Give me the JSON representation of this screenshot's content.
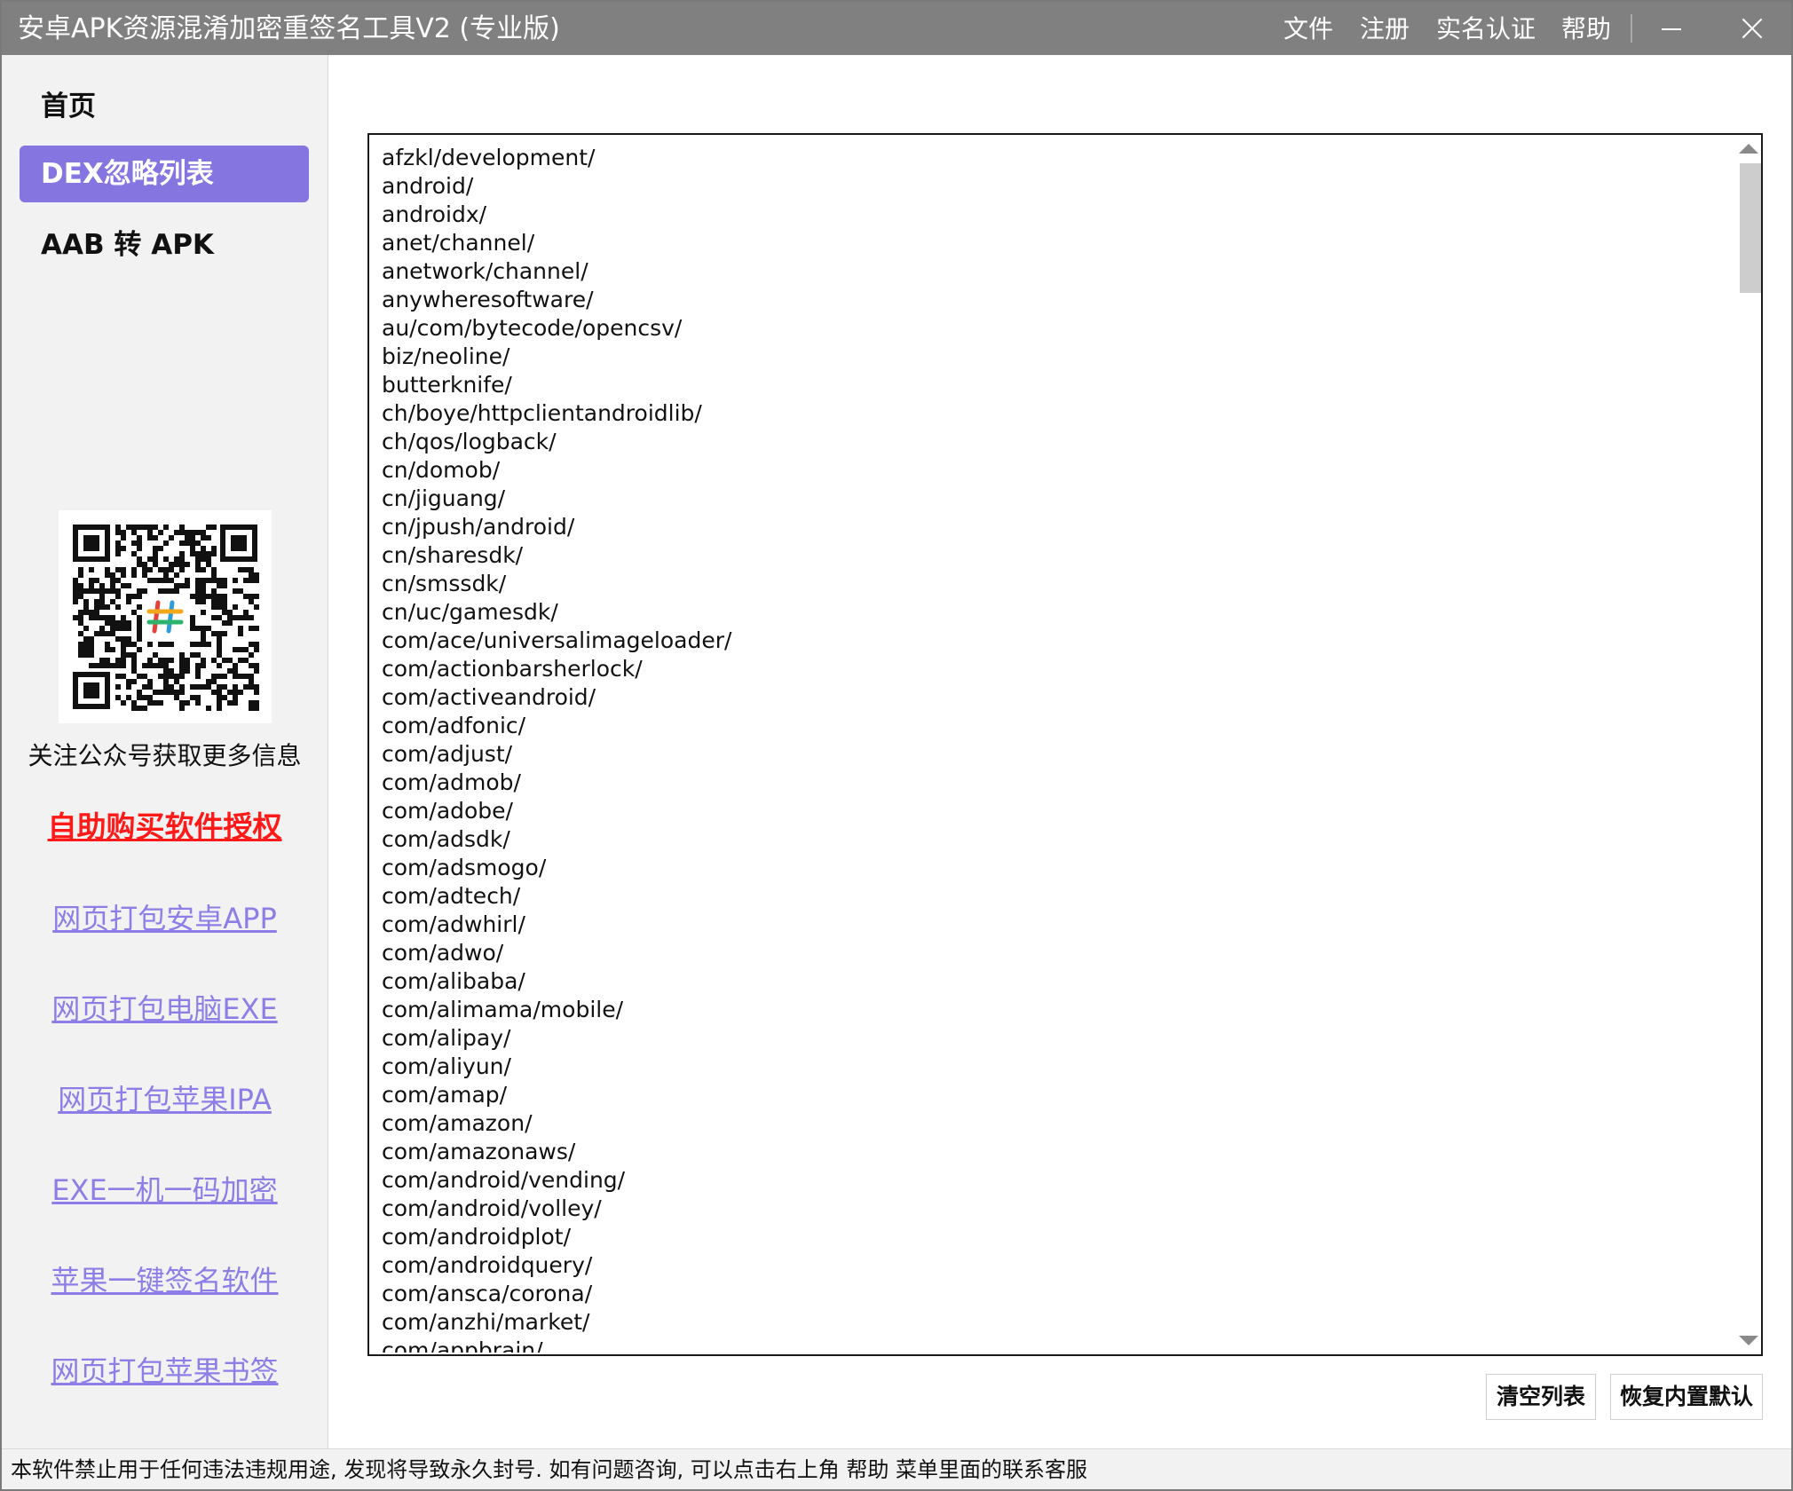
{
  "window": {
    "title": "安卓APK资源混淆加密重签名工具V2 (专业版)",
    "menu": {
      "file": "文件",
      "register": "注册",
      "realname": "实名认证",
      "help": "帮助"
    }
  },
  "sidebar": {
    "nav": [
      {
        "label": "首页"
      },
      {
        "label": "DEX忽略列表"
      },
      {
        "label": "AAB 转 APK"
      }
    ],
    "follow_text": "关注公众号获取更多信息",
    "buy_link": "自助购买软件授权",
    "links": [
      {
        "label": "网页打包安卓APP"
      },
      {
        "label": "网页打包电脑EXE"
      },
      {
        "label": "网页打包苹果IPA"
      },
      {
        "label": "EXE一机一码加密"
      },
      {
        "label": "苹果一键签名软件"
      },
      {
        "label": "网页打包苹果书签"
      }
    ]
  },
  "main": {
    "ignore_list": [
      "afzkl/development/",
      "android/",
      "androidx/",
      "anet/channel/",
      "anetwork/channel/",
      "anywheresoftware/",
      "au/com/bytecode/opencsv/",
      "biz/neoline/",
      "butterknife/",
      "ch/boye/httpclientandroidlib/",
      "ch/qos/logback/",
      "cn/domob/",
      "cn/jiguang/",
      "cn/jpush/android/",
      "cn/sharesdk/",
      "cn/smssdk/",
      "cn/uc/gamesdk/",
      "com/ace/universalimageloader/",
      "com/actionbarsherlock/",
      "com/activeandroid/",
      "com/adfonic/",
      "com/adjust/",
      "com/admob/",
      "com/adobe/",
      "com/adsdk/",
      "com/adsmogo/",
      "com/adtech/",
      "com/adwhirl/",
      "com/adwo/",
      "com/alibaba/",
      "com/alimama/mobile/",
      "com/alipay/",
      "com/aliyun/",
      "com/amap/",
      "com/amazon/",
      "com/amazonaws/",
      "com/android/vending/",
      "com/android/volley/",
      "com/androidplot/",
      "com/androidquery/",
      "com/ansca/corona/",
      "com/anzhi/market/",
      "com/appbrain/"
    ],
    "buttons": {
      "clear": "清空列表",
      "restore": "恢复内置默认"
    }
  },
  "statusbar": {
    "text": "本软件禁止用于任何违法违规用途, 发现将导致永久封号. 如有问题咨询, 可以点击右上角 帮助 菜单里面的联系客服"
  },
  "colors": {
    "titlebar": "#808080",
    "accent": "#8575e0",
    "link": "#8c7ee6",
    "buy_link": "#ff1a1a",
    "sidebar_bg": "#f2f2f2"
  },
  "icons": {
    "minimize": "minimize-icon",
    "close": "close-icon",
    "qr": "qr-code"
  }
}
